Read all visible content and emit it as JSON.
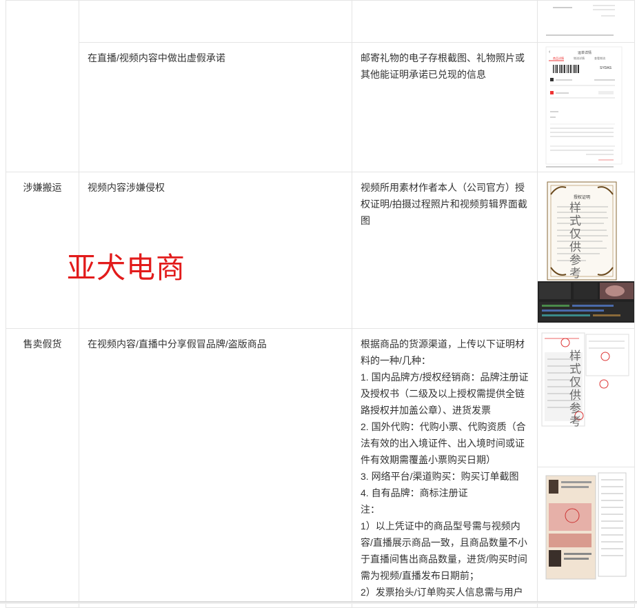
{
  "watermark": "亚犬电商",
  "stamp_text": "样式仅供参考",
  "rows": [
    {
      "category": "",
      "scenario": "",
      "evidence_lines": []
    },
    {
      "category": "",
      "scenario": "在直播/视频内容中做出虚假承诺",
      "evidence_lines": [
        "邮寄礼物的电子存根截图、礼物照片或其他能证明承诺已兑现的信息"
      ]
    },
    {
      "category": "涉嫌搬运",
      "scenario": "视频内容涉嫌侵权",
      "evidence_lines": [
        "视频所用素材作者本人（公司官方）授权证明/拍摄过程照片和视频剪辑界面截图"
      ]
    },
    {
      "category": "售卖假货",
      "scenario": "在视频内容/直播中分享假冒品牌/盗版商品",
      "evidence_lines": [
        "根据商品的货源渠道，上传以下证明材料的一种/几种：",
        "1. 国内品牌方/授权经销商：品牌注册证及授权书（二级及以上授权需提供全链路授权并加盖公章）、进货发票",
        "2. 国外代购：代购小票、代购资质（合法有效的出入境证件、出入境时间或证件有效期需覆盖小票购买日期）",
        "3. 网络平台/渠道购买：购买订单截图",
        "4. 自有品牌：商标注册证",
        "注：",
        "1）以上凭证中的商品型号需与视频内容/直播展示商品一致，且商品数量不小于直播间售出商品数量，进货/购买时间需为视频/直播发布日期前；",
        "2）发票抬头/订单购买人信息需与用户"
      ]
    }
  ],
  "thumbnails": {
    "order_screen": {
      "tabs": [
        "商品详情",
        "物流详情",
        "查看物流"
      ],
      "title": "运单详情",
      "code": "SYDAS"
    },
    "certificate": {
      "title": "授权证明"
    }
  }
}
